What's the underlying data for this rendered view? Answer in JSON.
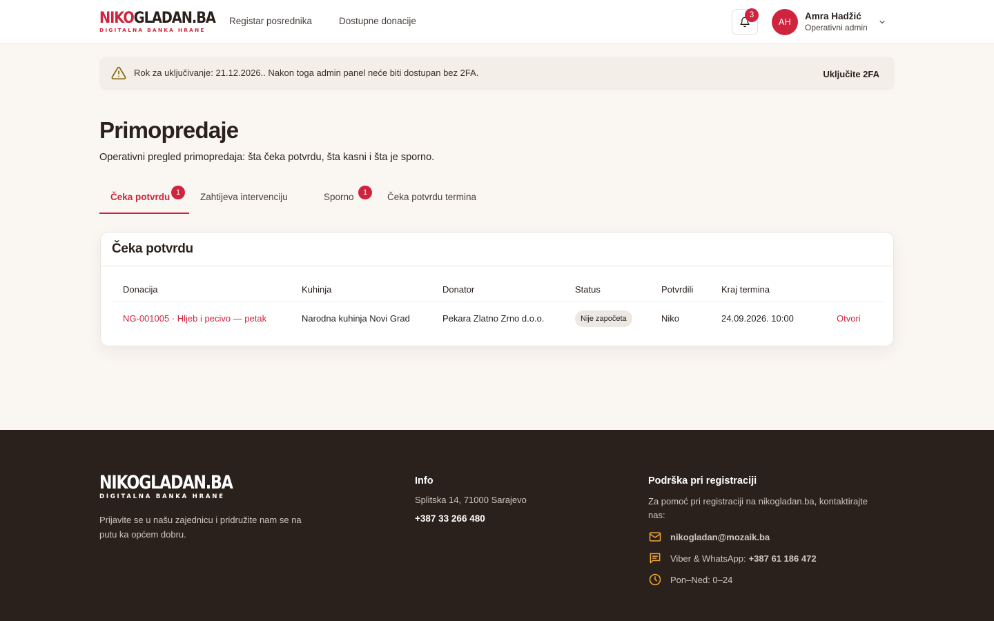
{
  "brand": {
    "logo_red": "NIKO",
    "logo_dark": "GLADAN.BA",
    "logo_full": "NIKOGLADAN.BA",
    "tagline": "DIGITALNA BANKA HRANE",
    "accent_color": "#d0243e"
  },
  "nav": {
    "items": [
      {
        "label": "Registar posrednika"
      },
      {
        "label": "Dostupne donacije"
      }
    ]
  },
  "notifications": {
    "count": "3",
    "icon": "bell-icon"
  },
  "user": {
    "initials": "AH",
    "name": "Amra Hadžić",
    "role": "Operativni admin"
  },
  "alert": {
    "text": "Rok za uključivanje: 21.12.2026.. Nakon toga admin panel neće biti dostupan bez 2FA.",
    "action": "Uključite 2FA",
    "icon": "warning-icon"
  },
  "page": {
    "title": "Primopredaje",
    "subtitle": "Operativni pregled primopredaja: šta čeka potvrdu, šta kasni i šta je sporno."
  },
  "tabs": [
    {
      "label": "Čeka potvrdu",
      "badge": "1",
      "active": true
    },
    {
      "label": "Zahtijeva intervenciju"
    },
    {
      "label": "Sporno",
      "badge": "1"
    },
    {
      "label": "Čeka potvrdu termina"
    }
  ],
  "card": {
    "title": "Čeka potvrdu",
    "columns": [
      "Donacija",
      "Kuhinja",
      "Donator",
      "Status",
      "Potvrdili",
      "Kraj termina"
    ],
    "rows": [
      {
        "donation": "NG-001005 · Hljeb i pecivo — petak",
        "kitchen": "Narodna kuhinja Novi Grad",
        "donor": "Pekara Zlatno Zrno d.o.o.",
        "status": "Nije započeta",
        "confirmed_by": "Niko",
        "end_time": "24.09.2026. 10:00",
        "action": "Otvori"
      }
    ]
  },
  "footer": {
    "logo": "NIKOGLADAN.BA",
    "logo_sub": "DIGITALNA BANKA HRANE",
    "tagline": "Prijavite se u našu zajednicu i pridružite nam se na putu ka općem dobru.",
    "info": {
      "heading": "Info",
      "address": "Splitska 14, 71000 Sarajevo",
      "phone": "+387 33 266 480"
    },
    "support": {
      "heading": "Podrška pri registraciji",
      "text": "Za pomoć pri registraciji na nikogladan.ba, kontaktirajte nas:",
      "email": "nikogladan@mozaik.ba",
      "messaging_label": "Viber & WhatsApp:",
      "messaging_number": "+387 61 186 472",
      "hours": "Pon–Ned: 0–24"
    },
    "accent_color": "#f0a93a"
  }
}
